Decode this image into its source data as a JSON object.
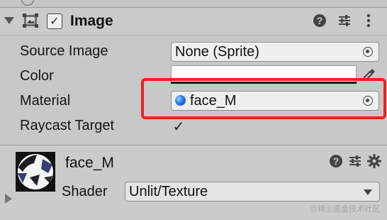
{
  "component": {
    "title": "Image",
    "enabled_mark": "✓",
    "icons": [
      "image-component-icon",
      "help-icon",
      "preset-icon",
      "more-icon"
    ]
  },
  "properties": {
    "source_image": {
      "label": "Source Image",
      "value": "None (Sprite)"
    },
    "color": {
      "label": "Color",
      "value_hex": "#ffffff"
    },
    "material": {
      "label": "Material",
      "value": "face_M"
    },
    "raycast_target": {
      "label": "Raycast Target",
      "checked_mark": "✓"
    }
  },
  "material_section": {
    "name": "face_M",
    "shader_label": "Shader",
    "shader_value": "Unlit/Texture",
    "icons": [
      "help-icon",
      "preset-icon",
      "settings-icon"
    ]
  },
  "watermark": "@稀土掘金技术社区",
  "colors": {
    "highlight": "#e5261f",
    "field_bg": "#efefef",
    "panel_bg": "#c8c8c8"
  }
}
